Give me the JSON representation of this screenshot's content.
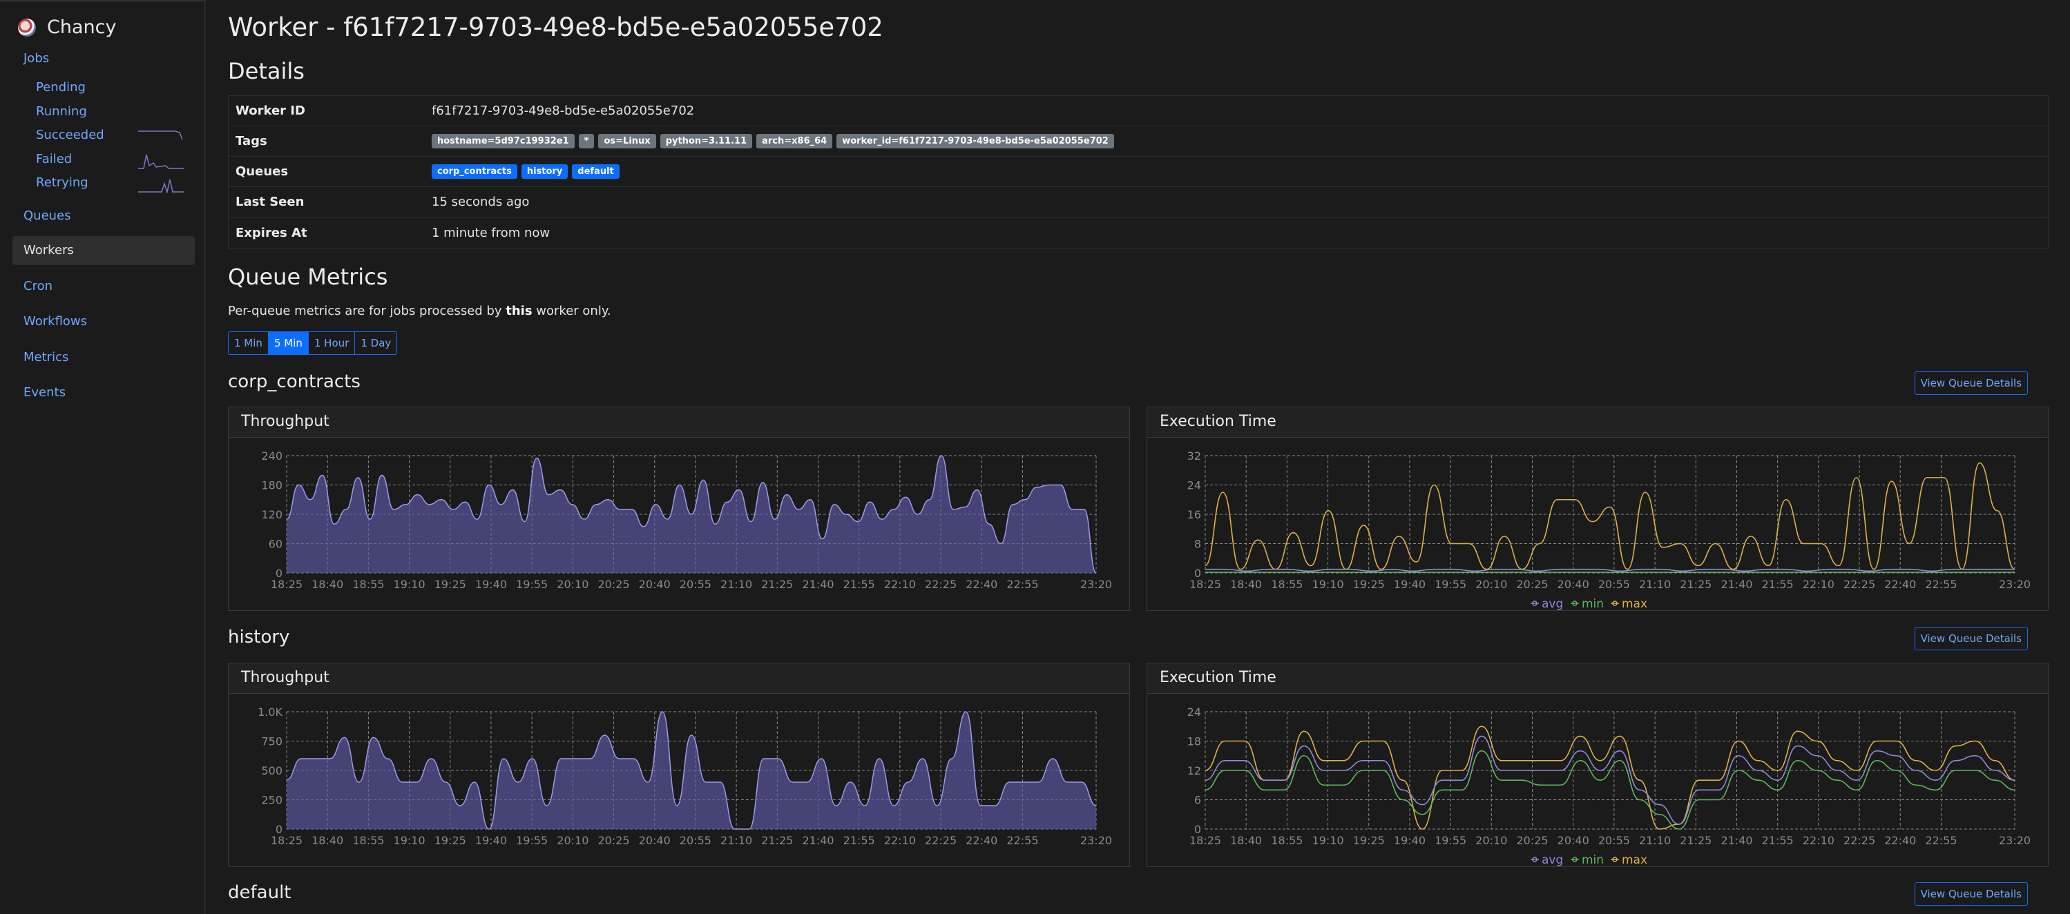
{
  "brand": {
    "name": "Chancy"
  },
  "sidebar": {
    "jobs": "Jobs",
    "sub": [
      "Pending",
      "Running",
      "Succeeded",
      "Failed",
      "Retrying"
    ],
    "items": [
      "Queues",
      "Workers",
      "Cron",
      "Workflows",
      "Metrics",
      "Events"
    ],
    "active": "Workers"
  },
  "page": {
    "title": "Worker - f61f7217-9703-49e8-bd5e-e5a02055e702"
  },
  "details": {
    "heading": "Details",
    "worker_id_label": "Worker ID",
    "worker_id": "f61f7217-9703-49e8-bd5e-e5a02055e702",
    "tags_label": "Tags",
    "tags": [
      "hostname=5d97c19932e1",
      "*",
      "os=Linux",
      "python=3.11.11",
      "arch=x86_64",
      "worker_id=f61f7217-9703-49e8-bd5e-e5a02055e702"
    ],
    "queues_label": "Queues",
    "queues": [
      "corp_contracts",
      "history",
      "default"
    ],
    "last_seen_label": "Last Seen",
    "last_seen": "15 seconds ago",
    "expires_label": "Expires At",
    "expires": "1 minute from now"
  },
  "metrics": {
    "heading": "Queue Metrics",
    "note_pre": "Per-queue metrics are for jobs processed by ",
    "note_bold": "this",
    "note_post": " worker only.",
    "ranges": [
      "1 Min",
      "5 Min",
      "1 Hour",
      "1 Day"
    ],
    "active_range": "5 Min",
    "view_details": "View Queue Details",
    "throughput_title": "Throughput",
    "exec_title": "Execution Time",
    "legend": [
      "avg",
      "min",
      "max"
    ]
  },
  "colors": {
    "accent": "#0d6efd",
    "link": "#6ea8fe",
    "throughput": "#7b79c9",
    "avg": "#8d8bd8",
    "min": "#5cb85c",
    "max": "#e0b04a"
  },
  "chart_data": [
    {
      "type": "area",
      "queue": "corp_contracts",
      "title": "Throughput",
      "x": [
        "18:25",
        "18:40",
        "18:55",
        "19:10",
        "19:25",
        "19:40",
        "19:55",
        "20:10",
        "20:25",
        "20:40",
        "20:55",
        "21:10",
        "21:25",
        "21:40",
        "21:55",
        "22:10",
        "22:25",
        "22:40",
        "22:55",
        "23:20"
      ],
      "ylim": [
        0,
        240
      ],
      "yticks": [
        "0",
        "60",
        "120",
        "180",
        "240"
      ],
      "values": [
        110,
        180,
        150,
        200,
        100,
        130,
        195,
        110,
        200,
        130,
        140,
        160,
        140,
        150,
        130,
        145,
        110,
        180,
        140,
        170,
        105,
        235,
        160,
        170,
        140,
        110,
        140,
        150,
        130,
        130,
        95,
        140,
        110,
        180,
        120,
        190,
        100,
        145,
        170,
        105,
        185,
        110,
        160,
        130,
        150,
        70,
        140,
        120,
        105,
        145,
        110,
        130,
        155,
        120,
        150,
        240,
        130,
        135,
        170,
        100,
        60,
        140,
        150,
        175,
        180,
        180,
        130,
        130,
        0
      ]
    },
    {
      "type": "line",
      "queue": "corp_contracts",
      "title": "Execution Time",
      "x": [
        "18:25",
        "18:40",
        "18:55",
        "19:10",
        "19:25",
        "19:40",
        "19:55",
        "20:10",
        "20:25",
        "20:40",
        "20:55",
        "21:10",
        "21:25",
        "21:40",
        "21:55",
        "22:10",
        "22:25",
        "22:40",
        "22:55",
        "23:20"
      ],
      "ylim": [
        0,
        32
      ],
      "yticks": [
        "0",
        "8",
        "16",
        "24",
        "32"
      ],
      "series": [
        {
          "name": "avg",
          "values": [
            1,
            1,
            0.5,
            1,
            1,
            0.5,
            1,
            1,
            0.5,
            1,
            0.5,
            1,
            1,
            0.5,
            1,
            1,
            0.5,
            1,
            1,
            1,
            0.5,
            1,
            1,
            0.5,
            1,
            1,
            0.5,
            1,
            1,
            0.5,
            1,
            1,
            0.5,
            1,
            1,
            0.5,
            1,
            1,
            1,
            1
          ]
        },
        {
          "name": "min",
          "values": [
            0.2,
            0.2,
            0.2,
            0.2,
            0.2,
            0.2,
            0.2,
            0.2,
            0.2,
            0.2,
            0.2,
            0.2,
            0.2,
            0.2,
            0.2,
            0.2,
            0.2,
            0.2,
            0.2,
            0.2,
            0.2,
            0.2,
            0.2,
            0.2,
            0.2,
            0.2,
            0.2,
            0.2,
            0.2,
            0.2,
            0.2,
            0.2,
            0.2,
            0.2,
            0.2,
            0.2,
            0.2,
            0.2,
            0.2,
            0.2
          ]
        },
        {
          "name": "max",
          "values": [
            2,
            22,
            1,
            9,
            1,
            11,
            2,
            17,
            1,
            13,
            1,
            10,
            3,
            24,
            8,
            8,
            1,
            10,
            1,
            8,
            20,
            20,
            14,
            18,
            1,
            22,
            7,
            8,
            2,
            8,
            1,
            10,
            2,
            20,
            8,
            8,
            2,
            26,
            1,
            25,
            8,
            26,
            26,
            1,
            30,
            17,
            1
          ]
        }
      ]
    },
    {
      "type": "area",
      "queue": "history",
      "title": "Throughput",
      "x": [
        "18:25",
        "18:40",
        "18:55",
        "19:10",
        "19:25",
        "19:40",
        "19:55",
        "20:10",
        "20:25",
        "20:40",
        "20:55",
        "21:10",
        "21:25",
        "21:40",
        "21:55",
        "22:10",
        "22:25",
        "22:40",
        "22:55",
        "23:20"
      ],
      "ylim": [
        0,
        1000
      ],
      "yticks": [
        "0",
        "250",
        "500",
        "750",
        "1.0K"
      ],
      "values": [
        420,
        600,
        600,
        600,
        780,
        400,
        780,
        600,
        400,
        400,
        600,
        400,
        200,
        400,
        0,
        600,
        400,
        600,
        200,
        600,
        600,
        600,
        800,
        600,
        600,
        400,
        1000,
        200,
        800,
        400,
        400,
        0,
        0,
        600,
        600,
        400,
        400,
        600,
        200,
        400,
        200,
        600,
        200,
        400,
        600,
        200,
        600,
        1000,
        200,
        200,
        400,
        400,
        400,
        600,
        400,
        400,
        200
      ]
    },
    {
      "type": "line",
      "queue": "history",
      "title": "Execution Time",
      "x": [
        "18:25",
        "18:40",
        "18:55",
        "19:10",
        "19:25",
        "19:40",
        "19:55",
        "20:10",
        "20:25",
        "20:40",
        "20:55",
        "21:10",
        "21:25",
        "21:40",
        "21:55",
        "22:10",
        "22:25",
        "22:40",
        "22:55",
        "23:20"
      ],
      "ylim": [
        0,
        24
      ],
      "yticks": [
        "0",
        "6",
        "12",
        "18",
        "24"
      ],
      "series": [
        {
          "name": "avg",
          "values": [
            10,
            14,
            14,
            10,
            10,
            17,
            12,
            12,
            14,
            14,
            8,
            5,
            10,
            10,
            19,
            12,
            12,
            12,
            12,
            16,
            12,
            16,
            8,
            5,
            1,
            8,
            8,
            15,
            12,
            10,
            17,
            15,
            12,
            10,
            16,
            15,
            12,
            10,
            14,
            15,
            12,
            10
          ]
        },
        {
          "name": "min",
          "values": [
            8,
            12,
            12,
            8,
            8,
            15,
            9,
            9,
            12,
            12,
            6,
            3,
            8,
            8,
            16,
            10,
            10,
            9,
            9,
            14,
            10,
            14,
            6,
            3,
            0,
            6,
            6,
            12,
            10,
            8,
            14,
            12,
            10,
            8,
            14,
            12,
            9,
            8,
            12,
            12,
            10,
            8
          ]
        },
        {
          "name": "max",
          "values": [
            12,
            18,
            18,
            10,
            10,
            20,
            14,
            14,
            18,
            18,
            10,
            0,
            12,
            12,
            21,
            14,
            14,
            14,
            14,
            19,
            14,
            19,
            10,
            0,
            1,
            10,
            10,
            18,
            14,
            12,
            20,
            18,
            14,
            12,
            18,
            18,
            14,
            12,
            17,
            18,
            14,
            10
          ]
        }
      ]
    }
  ],
  "next_queue": "default"
}
